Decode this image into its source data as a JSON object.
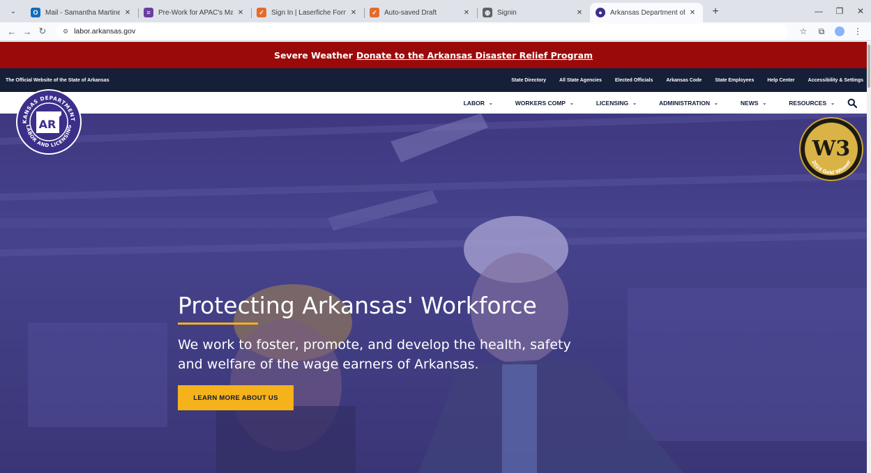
{
  "browser": {
    "tabs": [
      {
        "title": "Mail - Samantha Martinez (ADL",
        "favicon_color": "#0f6cbd",
        "favicon_glyph": "O"
      },
      {
        "title": "Pre-Work for APAC's Managing",
        "favicon_color": "#6b3fa0",
        "favicon_glyph": "≡"
      },
      {
        "title": "Sign In | Laserfiche Forms",
        "favicon_color": "#e46b2b",
        "favicon_glyph": "✓"
      },
      {
        "title": "Auto-saved Draft",
        "favicon_color": "#e46b2b",
        "favicon_glyph": "✓"
      },
      {
        "title": "Signin",
        "favicon_color": "#5f6368",
        "favicon_glyph": "◍"
      },
      {
        "title": "Arkansas Department of Labor",
        "favicon_color": "#3b2f8a",
        "favicon_glyph": "●"
      }
    ],
    "url": "labor.arkansas.gov"
  },
  "alert": {
    "bold": "Severe Weather",
    "link": "Donate to the Arkansas Disaster Relief Program"
  },
  "state_bar": {
    "official": "The Official Website of the State of Arkansas",
    "links": [
      "State Directory",
      "All State Agencies",
      "Elected Officials",
      "Arkansas Code",
      "State Employees",
      "Help Center",
      "Accessibility & Settings"
    ]
  },
  "nav": {
    "items": [
      "LABOR",
      "WORKERS COMP",
      "LICENSING",
      "ADMINISTRATION",
      "NEWS",
      "RESOURCES"
    ]
  },
  "logo": {
    "top_text": "ARKANSAS DEPARTMENT OF",
    "bottom_text": "LABOR AND LICENSING",
    "mark": "AR"
  },
  "award": {
    "mark": "W3",
    "caption": "2024 Gold Winner"
  },
  "hero": {
    "title": "Protecting Arkansas' Workforce",
    "description": "We work to foster, promote, and develop the health, safety and welfare of the wage earners of Arkansas.",
    "button": "LEARN MORE ABOUT US"
  },
  "colors": {
    "alert_red": "#9b0a0a",
    "navy": "#151f38",
    "gold": "#f5b21b",
    "hero_purple": "#4a4a8e"
  }
}
